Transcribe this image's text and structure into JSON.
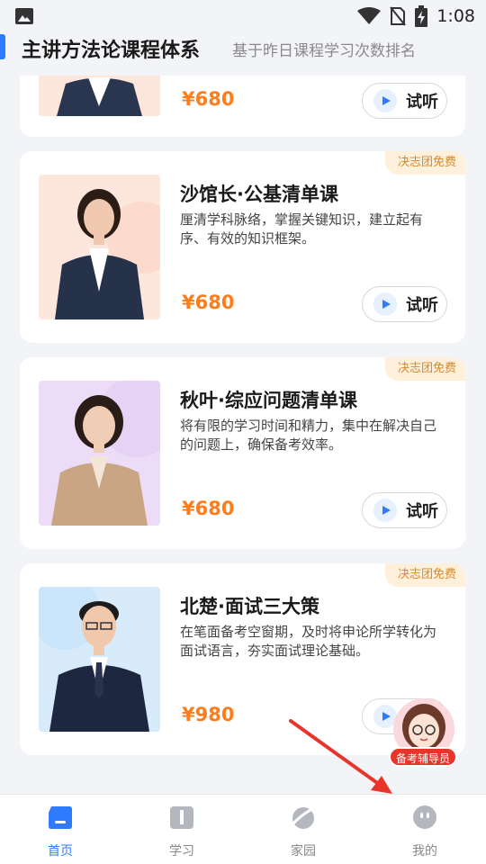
{
  "status_bar": {
    "time": "1:08",
    "icons": [
      "image-icon",
      "wifi-icon",
      "no-sim-icon",
      "battery-charging-icon"
    ]
  },
  "header": {
    "title": "主讲方法论课程体系",
    "subtitle": "基于昨日课程学习次数排名"
  },
  "courses": [
    {
      "badge": "",
      "title": "",
      "desc": "",
      "price": "¥680",
      "listen_label": "试听"
    },
    {
      "badge": "决志团免费",
      "title": "沙馆长·公基清单课",
      "desc": "厘清学科脉络，掌握关键知识，建立起有序、有效的知识框架。",
      "price": "¥680",
      "listen_label": "试听"
    },
    {
      "badge": "决志团免费",
      "title": "秋叶·综应问题清单课",
      "desc": "将有限的学习时间和精力，集中在解决自己的问题上，确保备考效率。",
      "price": "¥680",
      "listen_label": "试听"
    },
    {
      "badge": "决志团免费",
      "title": "北楚·面试三大策",
      "desc": "在笔面备考空窗期，及时将申论所学转化为面试语言，夯实面试理论基础。",
      "price": "¥980",
      "listen_label": "试听"
    }
  ],
  "assistant": {
    "label": "备考辅导员"
  },
  "bottom_nav": [
    {
      "label": "首页",
      "icon": "home-icon",
      "active": true
    },
    {
      "label": "学习",
      "icon": "book-icon",
      "active": false
    },
    {
      "label": "家园",
      "icon": "planet-icon",
      "active": false
    },
    {
      "label": "我的",
      "icon": "profile-icon",
      "active": false
    }
  ],
  "colors": {
    "accent": "#2f7bff",
    "price": "#ff7d1a",
    "badge_bg": "#fff0dc",
    "badge_text": "#d28a2c",
    "annotation_arrow": "#e8352c"
  }
}
